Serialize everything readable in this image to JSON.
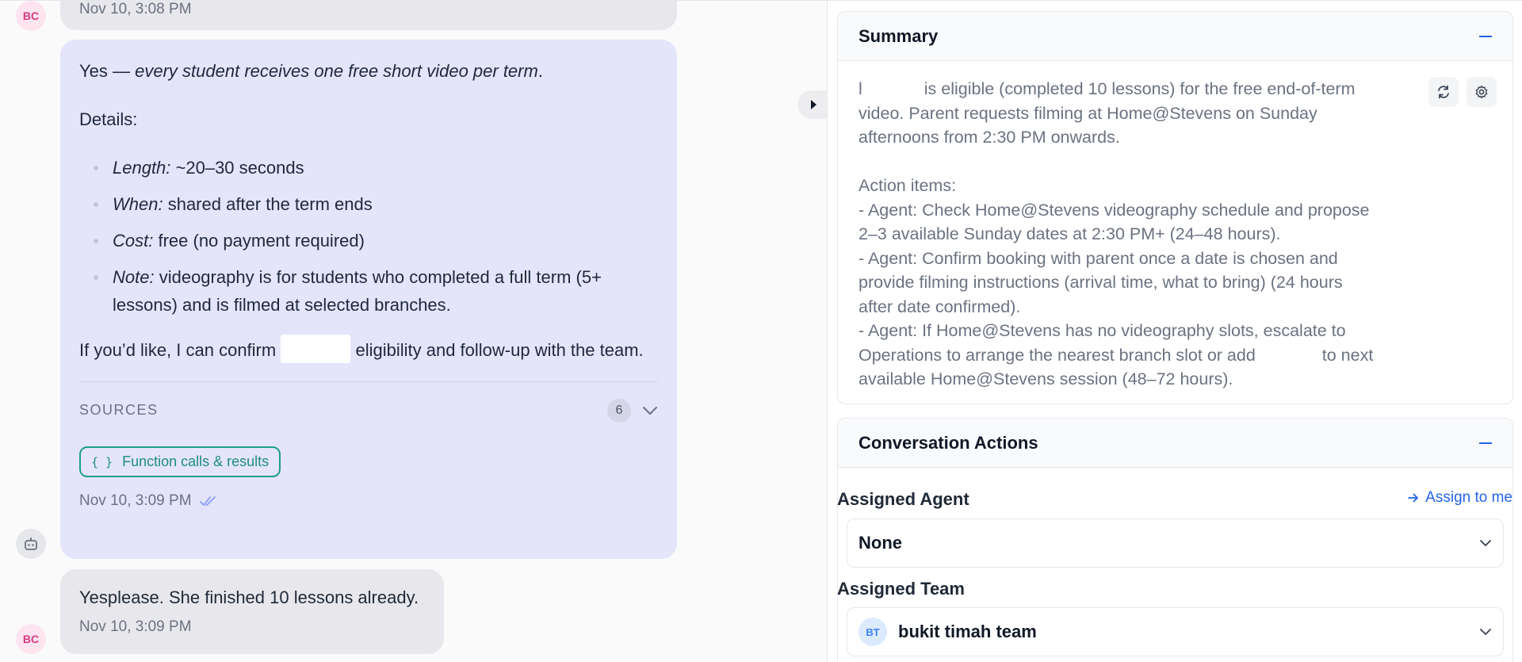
{
  "chat": {
    "msg_top": {
      "avatar": "BC",
      "timestamp": "Nov 10, 3:08 PM"
    },
    "msg_bot": {
      "avatar_icon": "robot-icon",
      "intro_prefix": "Yes — ",
      "intro_emph": "every student receives one free short video per term",
      "intro_suffix": ".",
      "details_label": "Details:",
      "bullets": [
        {
          "key": "Length:",
          "text": " ~20–30 seconds"
        },
        {
          "key": "When:",
          "text": " shared after the term ends"
        },
        {
          "key": "Cost:",
          "text": " free (no payment required)"
        },
        {
          "key": "Note:",
          "text": " videography is for students who completed a full term (5+ lessons) and is filmed at selected branches."
        }
      ],
      "confirm_prefix": "If you’d like, I can confirm",
      "confirm_suffix": "eligibility and follow-up with the team.",
      "sources_label": "SOURCES",
      "sources_count": "6",
      "function_chip_icon": "{ }",
      "function_chip_label": "Function calls & results",
      "timestamp": "Nov 10, 3:09 PM"
    },
    "msg_last": {
      "avatar": "BC",
      "text": "Yesplease. She finished 10 lessons already.",
      "timestamp": "Nov 10, 3:09 PM"
    }
  },
  "panel": {
    "summary": {
      "title": "Summary",
      "line1_prefix": "l",
      "line1_suffix": "is eligible (completed 10 lessons) for the free end-of-term",
      "line2": "video. Parent requests filming at Home@Stevens on Sunday",
      "line3": "afternoons from 2:30 PM onwards.",
      "line4": "Action items:",
      "line5": "- Agent: Check Home@Stevens videography schedule and propose",
      "line6": "2–3 available Sunday dates at 2:30 PM+ (24–48 hours).",
      "line7": "- Agent: Confirm booking with parent once a date is chosen and",
      "line8": "provide filming instructions (arrival time, what to bring) (24 hours",
      "line9": "after date confirmed).",
      "line10": "- Agent: If Home@Stevens has no videography slots, escalate to",
      "line11_prefix": "Operations to arrange the nearest branch slot or add",
      "line11_suffix": "to next",
      "line12": "available Home@Stevens session (48–72 hours)."
    },
    "actions": {
      "title": "Conversation Actions",
      "assigned_agent_label": "Assigned Agent",
      "assign_to_me": "Assign to me",
      "agent_value": "None",
      "assigned_team_label": "Assigned Team",
      "team_avatar": "BT",
      "team_value": "bukit timah team"
    }
  },
  "colors": {
    "bot_bubble": "#e4e4fb",
    "user_bubble": "#e8e8ec",
    "accent_blue": "#2563eb",
    "chip_teal": "#1e9e8f",
    "avatar_pink": "#d63b82"
  }
}
